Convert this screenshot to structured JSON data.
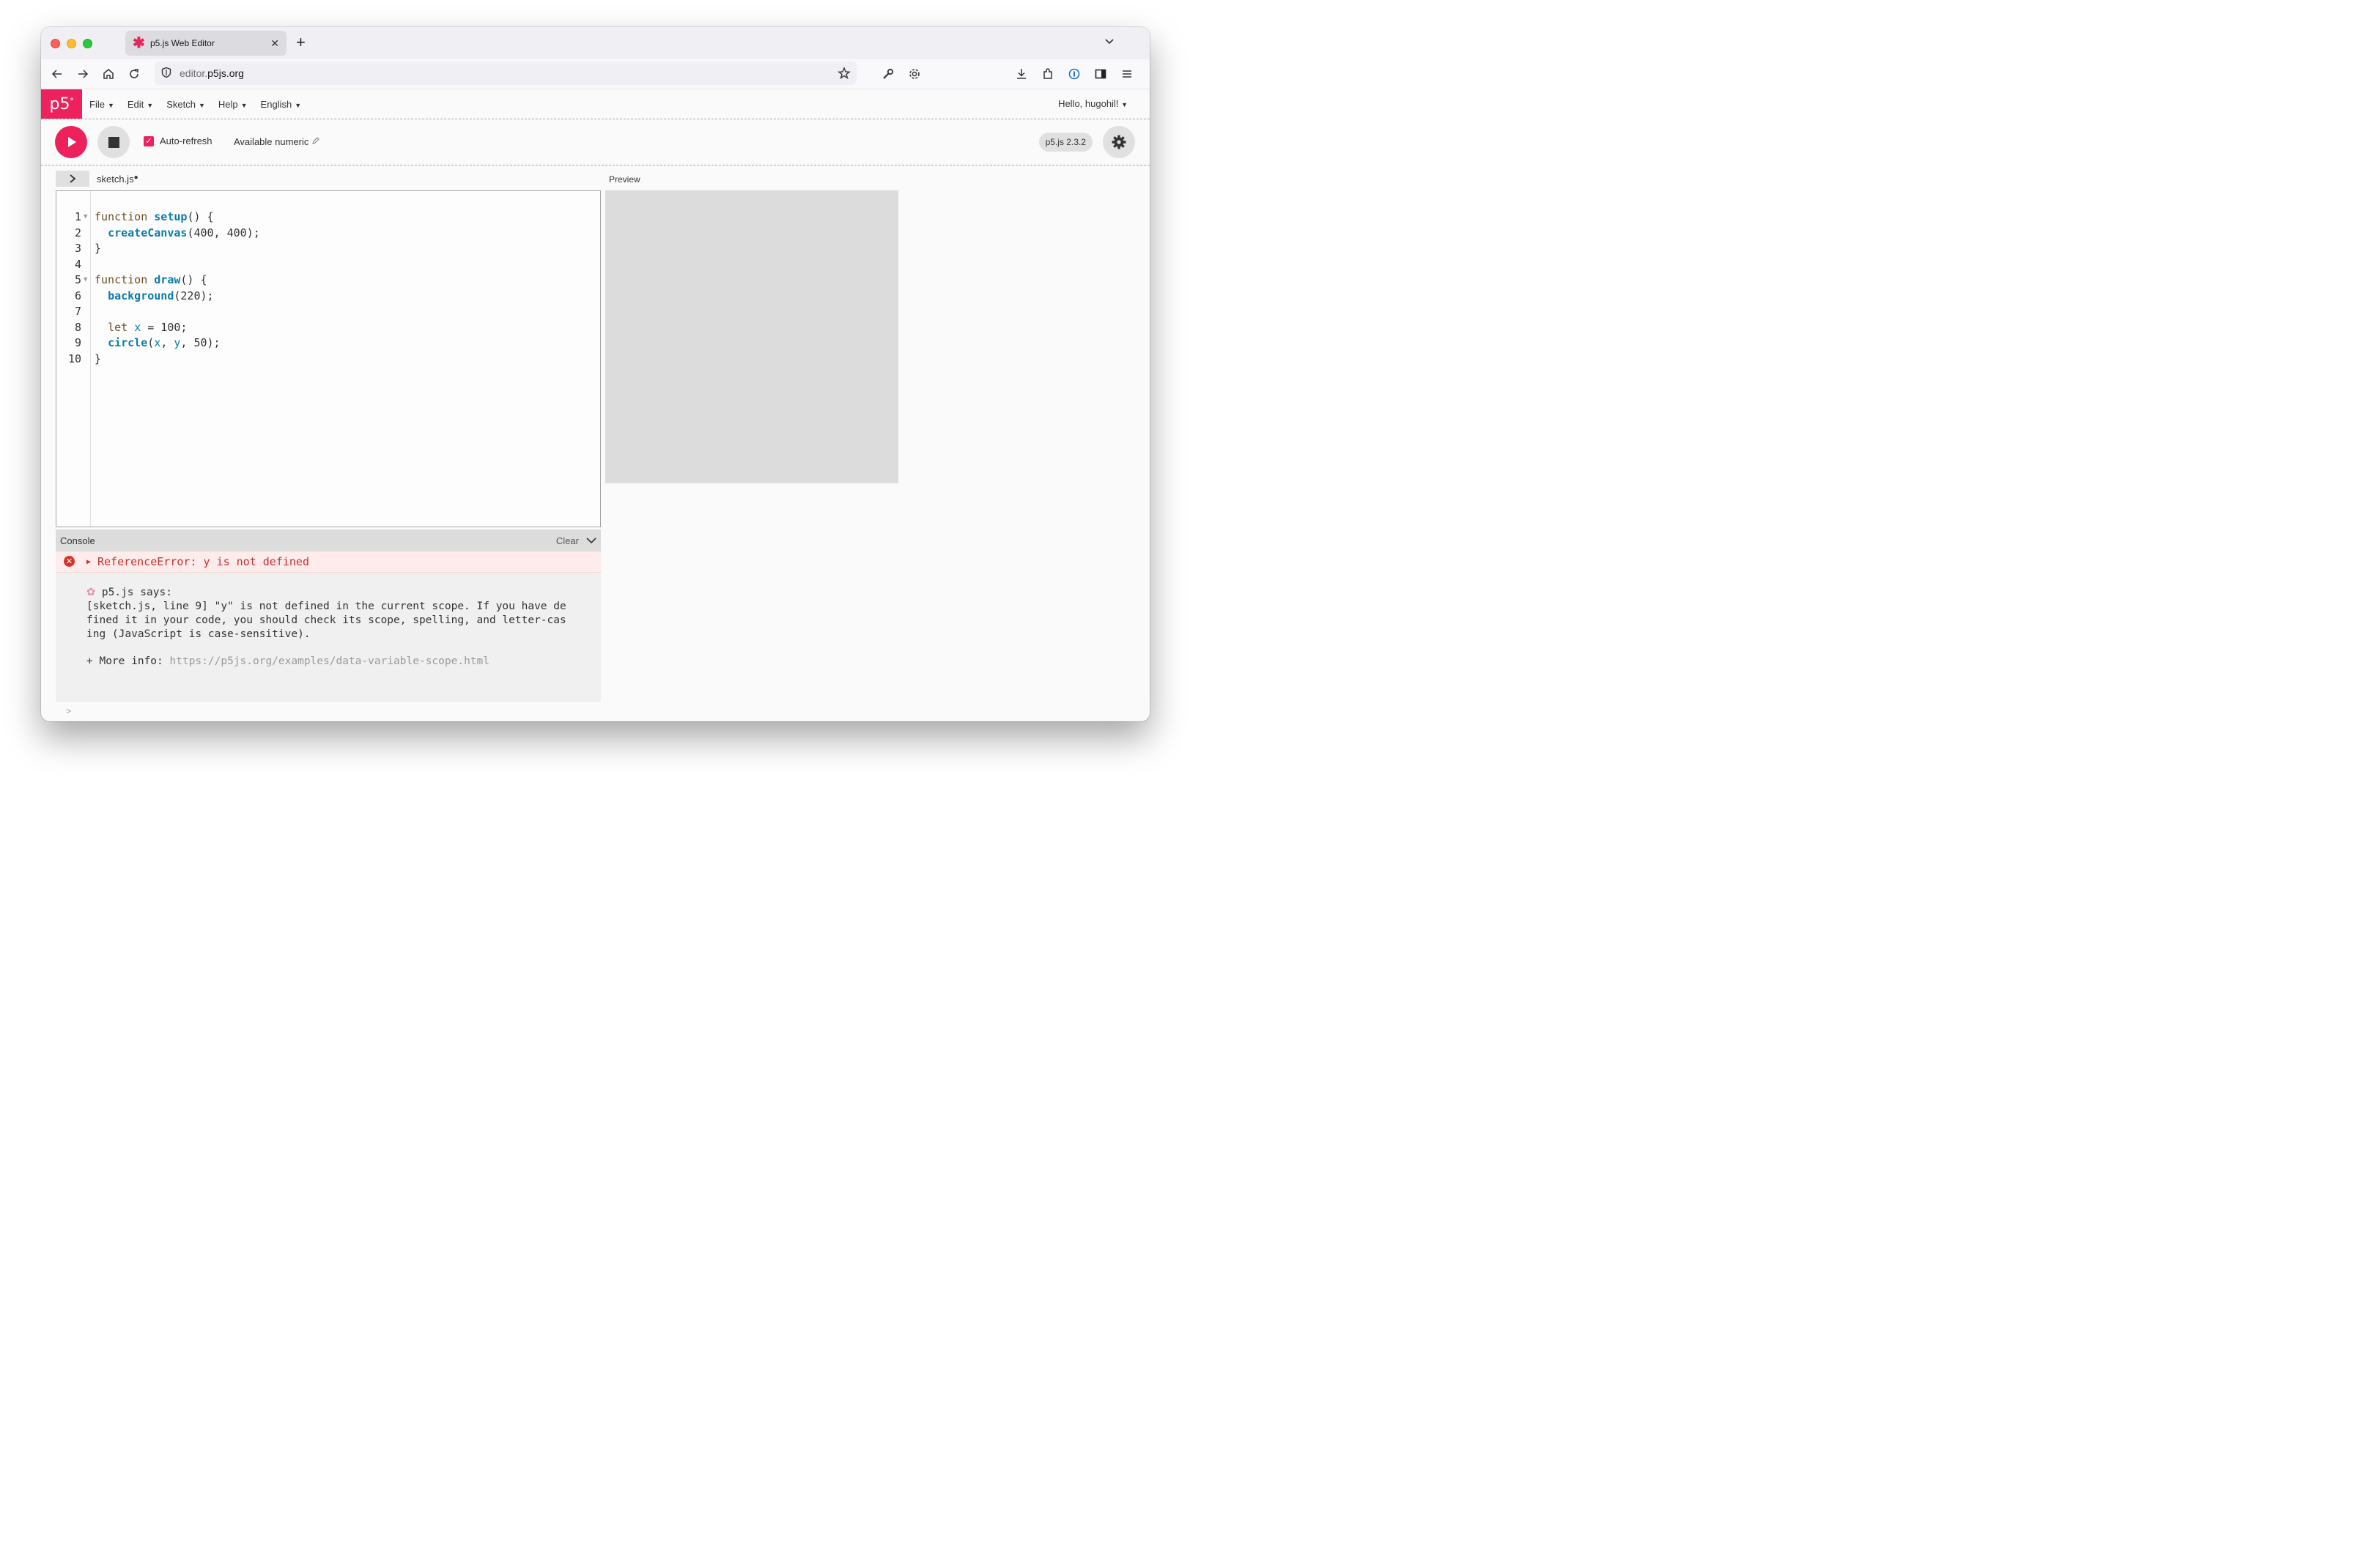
{
  "browser": {
    "tab_title": "p5.js Web Editor",
    "url_prefix": "editor.",
    "url_domain": "p5js.org"
  },
  "editor": {
    "logo": "p5",
    "logo_sup": "*",
    "menu": [
      "File",
      "Edit",
      "Sketch",
      "Help",
      "English"
    ],
    "user_greeting": "Hello, hugohil!",
    "toolbar": {
      "auto_refresh_label": "Auto-refresh",
      "sketch_name": "Available numeric",
      "version": "p5.js 2.3.2"
    },
    "file_tab": "sketch.js",
    "preview_label": "Preview"
  },
  "code": {
    "line_numbers": [
      "1",
      "2",
      "3",
      "4",
      "5",
      "6",
      "7",
      "8",
      "9",
      "10"
    ]
  },
  "console": {
    "title": "Console",
    "clear_label": "Clear",
    "error_text": "ReferenceError: y is not defined",
    "p5_says_label": "p5.js says:",
    "p5_message_lines": [
      "[sketch.js, line 9] \"y\" is not defined in the current scope. If you have de",
      "fined it in your code, you should check its scope, spelling, and letter-cas",
      "ing (JavaScript is case-sensitive)."
    ],
    "more_info_label": "+ More info:",
    "more_info_url": "https://p5js.org/examples/data-variable-scope.html",
    "prompt": ">"
  },
  "colors": {
    "p5_pink": "#ed225d",
    "error_line": "#f6cfcc",
    "active_line": "#efefef",
    "preview_bg": "#dcdcdc"
  }
}
